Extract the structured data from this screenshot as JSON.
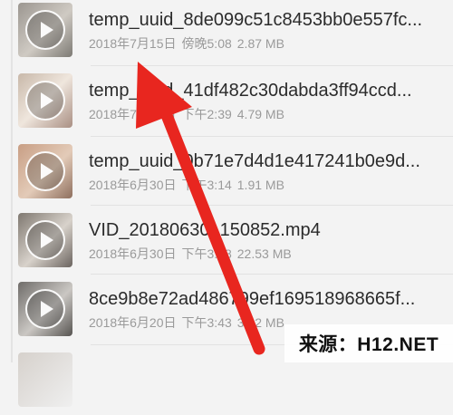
{
  "files": [
    {
      "name": "temp_uuid_8de099c51c8453bb0e557fc...",
      "date": "2018年7月15日",
      "time": "傍晚5:08",
      "size": "2.87 MB"
    },
    {
      "name": "temp_uuid_41df482c30dabda3ff94ccd...",
      "date": "2018年7月15日",
      "time": "下午2:39",
      "size": "4.79 MB"
    },
    {
      "name": "temp_uuid_0b71e7d4d1e417241b0e9d...",
      "date": "2018年6月30日",
      "time": "下午3:14",
      "size": "1.91 MB"
    },
    {
      "name": "VID_20180630_150852.mp4",
      "date": "2018年6月30日",
      "time": "下午3:08",
      "size": "22.53 MB"
    },
    {
      "name": "8ce9b8e72ad486799ef169518968665f...",
      "date": "2018年6月20日",
      "time": "下午3:43",
      "size": "3.12 MB"
    }
  ],
  "watermark": "来源：H12.NET",
  "colors": {
    "arrow": "#e8261f",
    "background": "#f3f3f3"
  }
}
